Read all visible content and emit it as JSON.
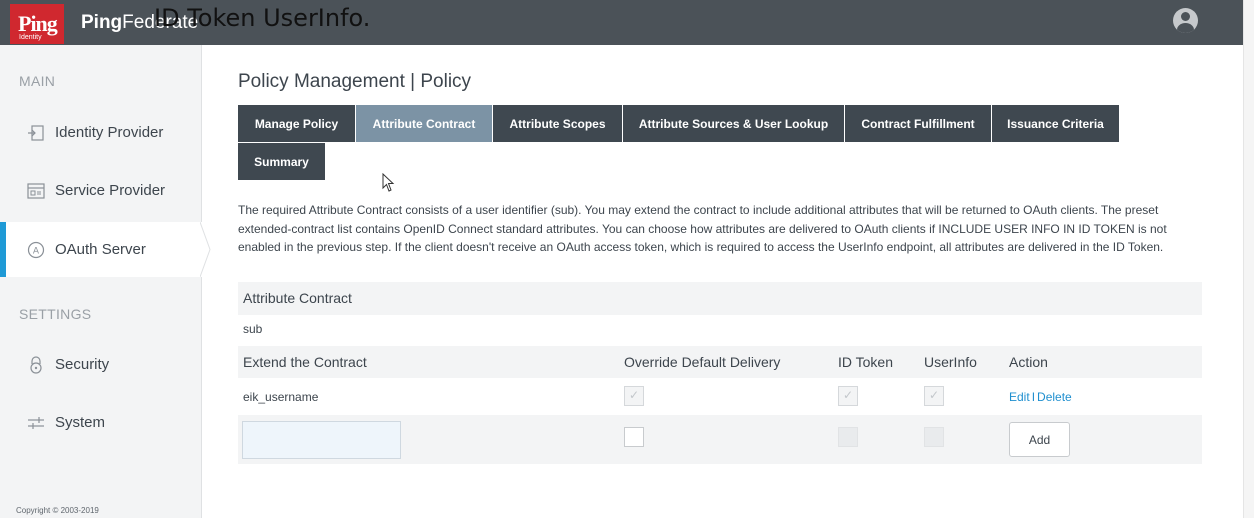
{
  "header": {
    "logo_text": "Ping",
    "logo_sub": "Identity",
    "brand_bold": "Ping",
    "brand_rest": "Federate",
    "caption": "ID Token UserInfo."
  },
  "sidebar": {
    "main_label": "MAIN",
    "settings_label": "SETTINGS",
    "items": [
      {
        "label": "Identity Provider",
        "icon": "identity-provider-icon"
      },
      {
        "label": "Service Provider",
        "icon": "service-provider-icon"
      },
      {
        "label": "OAuth Server",
        "icon": "oauth-server-icon"
      },
      {
        "label": "Security",
        "icon": "security-icon"
      },
      {
        "label": "System",
        "icon": "system-icon"
      }
    ],
    "copyright": "Copyright © 2003-2019"
  },
  "page": {
    "title": "Policy Management | Policy",
    "tabs": [
      "Manage Policy",
      "Attribute Contract",
      "Attribute Scopes",
      "Attribute Sources & User Lookup",
      "Contract Fulfillment",
      "Issuance Criteria",
      "Summary"
    ],
    "description": "The required Attribute Contract consists of a user identifier (sub). You may extend the contract to include additional attributes that will be returned to OAuth clients. The preset extended-contract list contains OpenID Connect standard attributes. You can choose how attributes are delivered to OAuth clients if INCLUDE USER INFO IN ID TOKEN is not enabled in the previous step. If the client doesn't receive an OAuth access token, which is required to access the UserInfo endpoint, all attributes are delivered in the ID Token."
  },
  "contract": {
    "section_title": "Attribute Contract",
    "core_attribute": "sub",
    "columns": [
      "Extend the Contract",
      "Override Default Delivery",
      "ID Token",
      "UserInfo",
      "Action"
    ],
    "rows": [
      {
        "name": "eik_username",
        "edit": "Edit",
        "sep": "I",
        "delete": "Delete"
      }
    ],
    "add_button": "Add"
  }
}
